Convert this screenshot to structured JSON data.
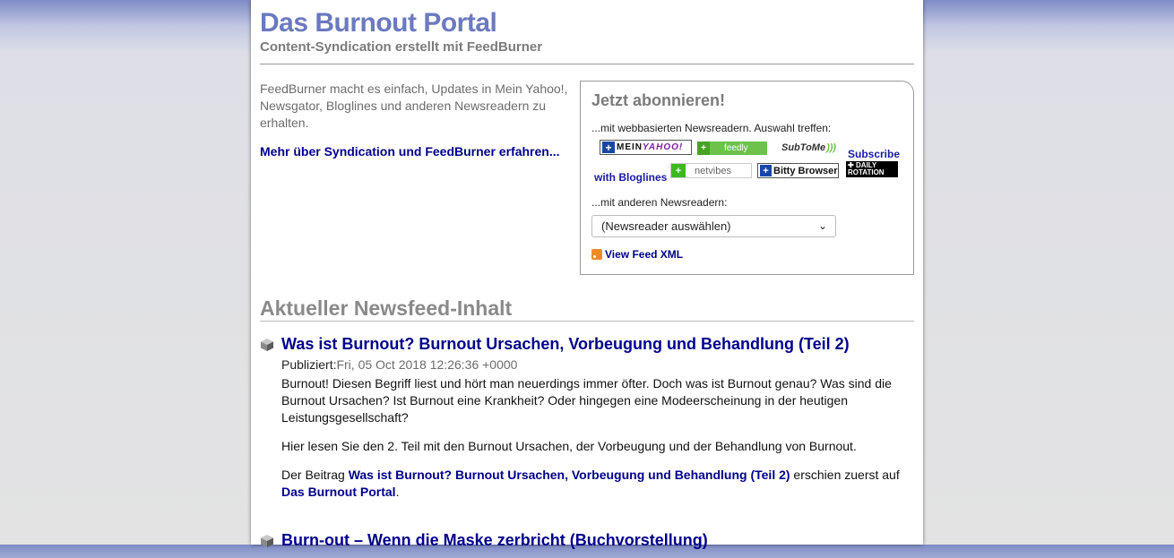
{
  "header": {
    "title": "Das Burnout Portal",
    "subtitle": "Content-Syndication erstellt mit FeedBurner"
  },
  "intro": {
    "text": "FeedBurner macht es einfach, Updates in Mein Yahoo!, Newsgator, Bloglines und anderen Newsreadern zu erhalten.",
    "link": "Mehr über Syndication und FeedBurner erfahren..."
  },
  "subscribe": {
    "heading": "Jetzt abonnieren!",
    "web_label": "...mit webbasierten Newsreadern. Auswahl treffen:",
    "badges": {
      "yahoo_prefix": "MEIN",
      "yahoo_brand": "YAHOO!",
      "feedly": "feedly",
      "subtome": "SubToMe",
      "subscribe_link": "Subscribe",
      "with_bloglines": "with Bloglines",
      "daily_line1": "DAILY",
      "daily_line2": "ROTATION",
      "netvibes": "netvibes",
      "bitty": "Bitty Browser"
    },
    "other_label": "...mit anderen Newsreadern:",
    "select_value": "(Newsreader auswählen)",
    "view_xml": "View Feed XML"
  },
  "feed": {
    "heading": "Aktueller Newsfeed-Inhalt",
    "items": [
      {
        "title": "Was ist Burnout? Burnout Ursachen, Vorbeugung und Behandlung (Teil 2)",
        "published_label": "Publiziert:",
        "published_date": "Fri, 05 Oct 2018 12:26:36 +0000",
        "p1": "Burnout! Diesen Begriff liest und hört man neuerdings immer öfter. Doch was ist Burnout genau? Was sind die Burnout Ursachen? Ist Burnout eine Krankheit? Oder hingegen eine Modeerscheinung in der heutigen Leistungsgesellschaft?",
        "p2": "Hier lesen Sie den 2. Teil mit den Burnout Ursachen, der Vorbeugung und der Behandlung von Burnout.",
        "p3_prefix": "Der Beitrag ",
        "p3_link": "Was ist Burnout? Burnout Ursachen, Vorbeugung und Behandlung (Teil 2)",
        "p3_mid": " erschien zuerst auf ",
        "p3_site": "Das Burnout Portal",
        "p3_end": "."
      },
      {
        "title": "Burn-out – Wenn die Maske zerbricht (Buchvorstellung)"
      }
    ]
  }
}
